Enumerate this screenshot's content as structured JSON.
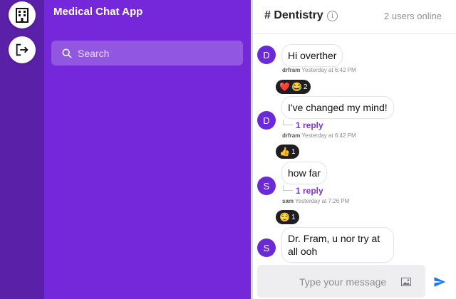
{
  "sidebar": {
    "app_title": "Medical Chat App",
    "search_placeholder": "Search",
    "icons": [
      "hospital-icon",
      "logout-icon"
    ]
  },
  "header": {
    "channel_name": "# Dentistry",
    "info_glyph": "i",
    "online_count": "2 users online"
  },
  "messages": [
    {
      "avatar": "D",
      "text": "Hi overther",
      "user": "drfram",
      "time": "Yesterday at 6:42 PM"
    },
    {
      "avatar": "D",
      "text": "I've changed my mind!",
      "user": "drfram",
      "time": "Yesterday at 6:42 PM",
      "reaction_count": "2",
      "reactions": [
        "❤️",
        "😂"
      ],
      "reply": "1 reply"
    },
    {
      "avatar": "S",
      "text": "how far",
      "user": "sam",
      "time": "Yesterday at 7:26 PM",
      "reaction_count": "1",
      "reactions": [
        "👍"
      ],
      "reply": "1 reply"
    },
    {
      "avatar": "S",
      "text_line1": "Dr. Fram, u nor try at",
      "text_line2": "all ooh",
      "reaction_count": "1",
      "reactions": [
        "😌"
      ]
    }
  ],
  "composer": {
    "placeholder": "Type your message"
  },
  "colors": {
    "rail": "#5b20a8",
    "panel": "#7428d9",
    "accent": "#6a2bd6",
    "send": "#1877f2"
  }
}
